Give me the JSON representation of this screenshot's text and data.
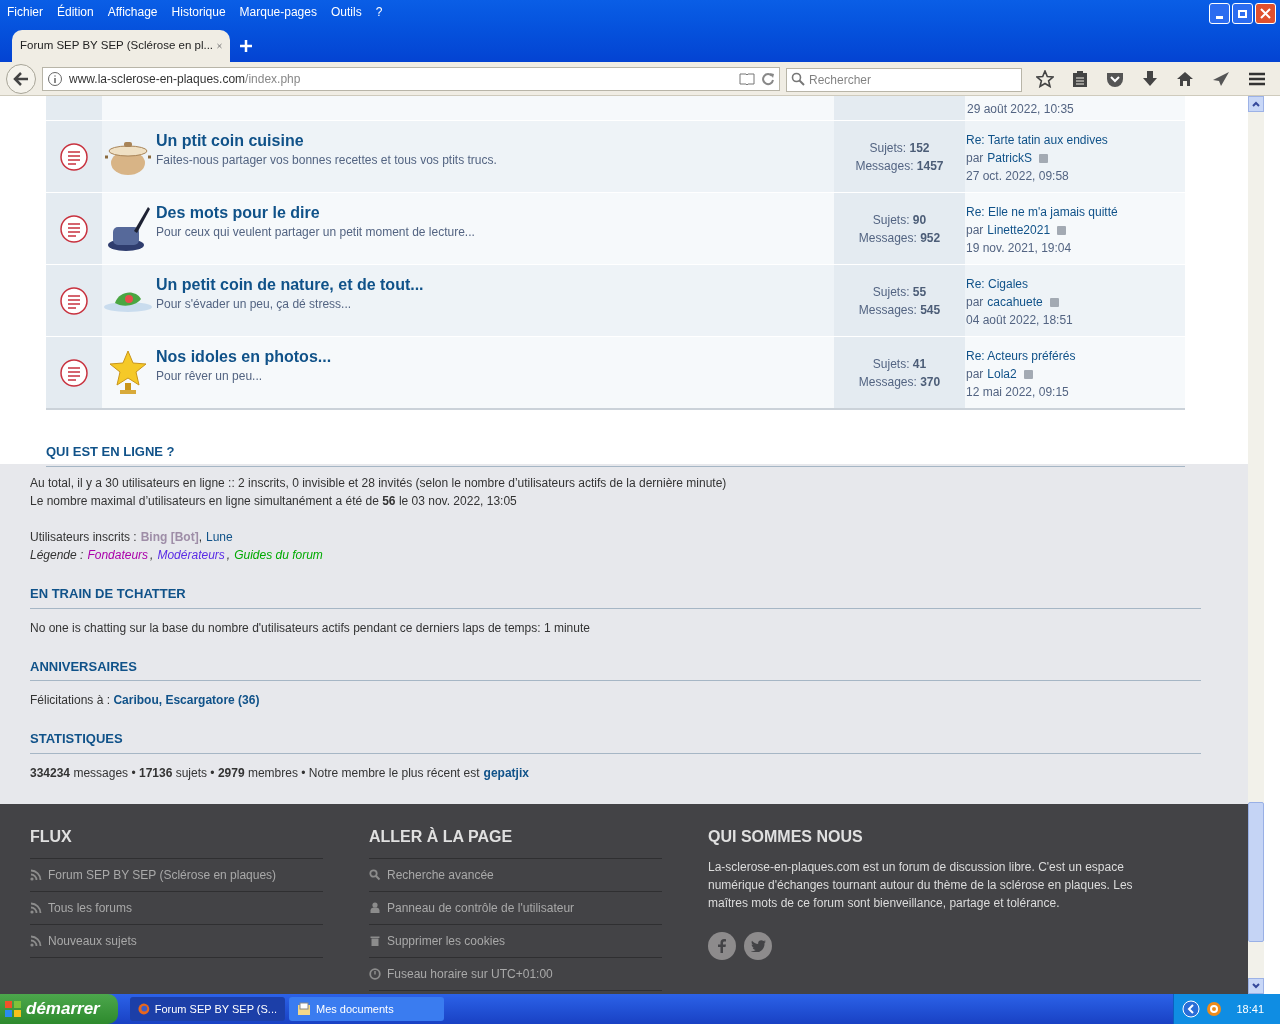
{
  "browser": {
    "menu": [
      "Fichier",
      "Édition",
      "Affichage",
      "Historique",
      "Marque-pages",
      "Outils",
      "?"
    ],
    "tabs": [
      {
        "label": "Forum SEP BY SEP (Sclérose en pl...",
        "selected": true
      }
    ],
    "url_domain": "www.la-sclerose-en-plaques.com",
    "url_path": "/index.php",
    "search": {
      "placeholder": "Rechercher"
    }
  },
  "forum_list": {
    "partial_last_post_date": "29 août 2022, 10:35",
    "forums": [
      {
        "title": "Un ptit coin cuisine",
        "description": "Faites-nous partager vos bonnes recettes et tous vos ptits trucs.",
        "topics_label": "Sujets:",
        "topics": "152",
        "posts_label": "Messages:",
        "posts": "1457",
        "last_post": {
          "title": "Re: Tarte tatin aux endives",
          "by": "par",
          "author": "PatrickS",
          "date": "27 oct. 2022, 09:58"
        }
      },
      {
        "title": "Des mots pour le dire",
        "description": "Pour ceux qui veulent partager un petit moment de lecture...",
        "topics_label": "Sujets:",
        "topics": "90",
        "posts_label": "Messages:",
        "posts": "952",
        "last_post": {
          "title": "Re: Elle ne m'a jamais quitté",
          "by": "par",
          "author": "Linette2021",
          "date": "19 nov. 2021, 19:04"
        }
      },
      {
        "title": "Un petit coin de nature, et de tout...",
        "description": "Pour s'évader un peu, ça dé stress...",
        "topics_label": "Sujets:",
        "topics": "55",
        "posts_label": "Messages:",
        "posts": "545",
        "last_post": {
          "title": "Re: Cigales",
          "by": "par",
          "author": "cacahuete",
          "date": "04 août 2022, 18:51"
        }
      },
      {
        "title": "Nos idoles en photos...",
        "description": "Pour rêver un peu...",
        "topics_label": "Sujets:",
        "topics": "41",
        "posts_label": "Messages:",
        "posts": "370",
        "last_post": {
          "title": "Re: Acteurs préférés",
          "by": "par",
          "author": "Lola2",
          "date": "12 mai 2022, 09:15"
        }
      }
    ]
  },
  "who_is_online": {
    "heading": "QUI EST EN LIGNE ?",
    "total": "Au total, il y a 30 utilisateurs en ligne :: 2 inscrits, 0 invisible et 28 invités (selon le nombre d’utilisateurs actifs de la dernière minute)",
    "record": "Le nombre maximal d’utilisateurs en ligne simultanément a été de **56** le 03 nov. 2022, 13:05",
    "registered_label": "Utilisateurs inscrits :",
    "separator": ",",
    "registered": [
      {
        "name": "Bing [Bot]",
        "color": "#9e8da7"
      },
      {
        "name": "Lune",
        "color": "#105289"
      }
    ],
    "legend_label": "Légende :",
    "groups": [
      {
        "name": "Fondateurs",
        "color": "#aa00aa"
      },
      {
        "name": "Modérateurs",
        "color": "#5a2be6"
      },
      {
        "name": "Guides du forum",
        "color": "#00aa00"
      }
    ]
  },
  "chat": {
    "heading": "EN TRAIN DE TCHATTER",
    "text": "No one is chatting sur la base du nombre d'utilisateurs actifs pendant ce derniers laps de temps: 1 minute"
  },
  "birthdays": {
    "heading": "ANNIVERSAIRES",
    "text": "Félicitations à : **Caribou, Escargatore (36)**"
  },
  "statistics": {
    "heading": "STATISTIQUES",
    "text": "**334234** messages • **17136** sujets • **2979** membres • Notre membre le plus récent est",
    "newest_member": "gepatjix"
  },
  "footer": {
    "columns": [
      {
        "heading": "FLUX",
        "links": [
          {
            "kind": "rss",
            "label": "Forum SEP BY SEP (Sclérose en plaques)"
          },
          {
            "kind": "rss",
            "label": "Tous les forums"
          },
          {
            "kind": "rss",
            "label": "Nouveaux sujets"
          }
        ]
      },
      {
        "heading": "ALLER À LA PAGE",
        "links": [
          {
            "kind": "search",
            "label": "Recherche avancée"
          },
          {
            "kind": "user",
            "label": "Panneau de contrôle de l'utilisateur"
          },
          {
            "kind": "trash",
            "label": "Supprimer les cookies"
          },
          {
            "kind": "clock",
            "label": "Fuseau horaire sur UTC+01:00"
          }
        ]
      },
      {
        "heading": "QUI SOMMES NOUS",
        "text": "La-sclerose-en-plaques.com est un forum de discussion libre. C'est un espace numérique d'échanges tournant autour du thème de la sclérose en plaques. Les maîtres mots de ce forum sont bienveillance, partage et tolérance."
      }
    ]
  },
  "taskbar": {
    "start": "démarrer",
    "tasks": [
      {
        "label": "Forum SEP BY SEP (S...",
        "selected": true
      },
      {
        "label": "Mes documents",
        "selected": false
      }
    ],
    "clock": "18:41"
  }
}
